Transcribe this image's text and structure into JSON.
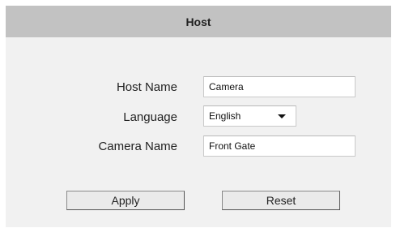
{
  "header": {
    "title": "Host"
  },
  "form": {
    "host_name": {
      "label": "Host Name",
      "value": "Camera"
    },
    "language": {
      "label": "Language",
      "selected": "English"
    },
    "camera_name": {
      "label": "Camera Name",
      "value": "Front Gate"
    }
  },
  "buttons": {
    "apply": "Apply",
    "reset": "Reset"
  }
}
